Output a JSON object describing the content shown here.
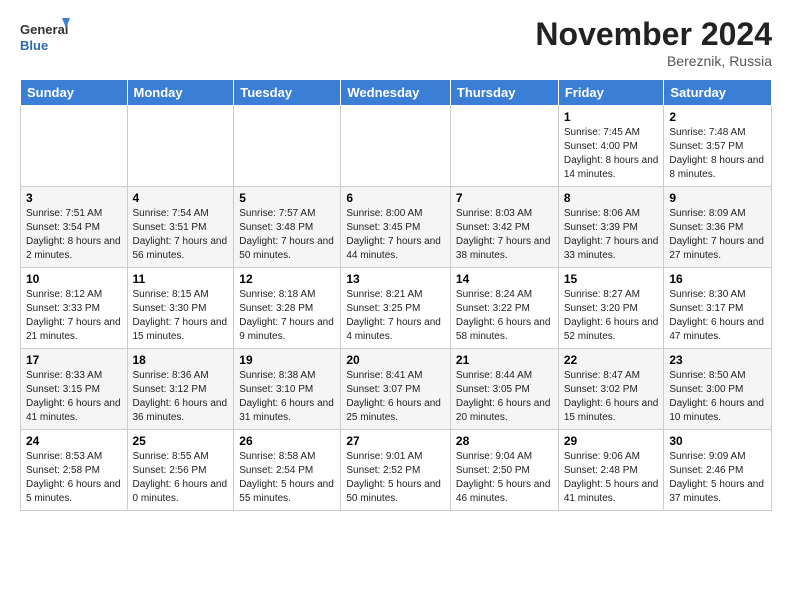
{
  "header": {
    "logo_general": "General",
    "logo_blue": "Blue",
    "month_title": "November 2024",
    "location": "Bereznik, Russia"
  },
  "weekdays": [
    "Sunday",
    "Monday",
    "Tuesday",
    "Wednesday",
    "Thursday",
    "Friday",
    "Saturday"
  ],
  "weeks": [
    [
      {
        "day": "",
        "info": ""
      },
      {
        "day": "",
        "info": ""
      },
      {
        "day": "",
        "info": ""
      },
      {
        "day": "",
        "info": ""
      },
      {
        "day": "",
        "info": ""
      },
      {
        "day": "1",
        "info": "Sunrise: 7:45 AM\nSunset: 4:00 PM\nDaylight: 8 hours and 14 minutes."
      },
      {
        "day": "2",
        "info": "Sunrise: 7:48 AM\nSunset: 3:57 PM\nDaylight: 8 hours and 8 minutes."
      }
    ],
    [
      {
        "day": "3",
        "info": "Sunrise: 7:51 AM\nSunset: 3:54 PM\nDaylight: 8 hours and 2 minutes."
      },
      {
        "day": "4",
        "info": "Sunrise: 7:54 AM\nSunset: 3:51 PM\nDaylight: 7 hours and 56 minutes."
      },
      {
        "day": "5",
        "info": "Sunrise: 7:57 AM\nSunset: 3:48 PM\nDaylight: 7 hours and 50 minutes."
      },
      {
        "day": "6",
        "info": "Sunrise: 8:00 AM\nSunset: 3:45 PM\nDaylight: 7 hours and 44 minutes."
      },
      {
        "day": "7",
        "info": "Sunrise: 8:03 AM\nSunset: 3:42 PM\nDaylight: 7 hours and 38 minutes."
      },
      {
        "day": "8",
        "info": "Sunrise: 8:06 AM\nSunset: 3:39 PM\nDaylight: 7 hours and 33 minutes."
      },
      {
        "day": "9",
        "info": "Sunrise: 8:09 AM\nSunset: 3:36 PM\nDaylight: 7 hours and 27 minutes."
      }
    ],
    [
      {
        "day": "10",
        "info": "Sunrise: 8:12 AM\nSunset: 3:33 PM\nDaylight: 7 hours and 21 minutes."
      },
      {
        "day": "11",
        "info": "Sunrise: 8:15 AM\nSunset: 3:30 PM\nDaylight: 7 hours and 15 minutes."
      },
      {
        "day": "12",
        "info": "Sunrise: 8:18 AM\nSunset: 3:28 PM\nDaylight: 7 hours and 9 minutes."
      },
      {
        "day": "13",
        "info": "Sunrise: 8:21 AM\nSunset: 3:25 PM\nDaylight: 7 hours and 4 minutes."
      },
      {
        "day": "14",
        "info": "Sunrise: 8:24 AM\nSunset: 3:22 PM\nDaylight: 6 hours and 58 minutes."
      },
      {
        "day": "15",
        "info": "Sunrise: 8:27 AM\nSunset: 3:20 PM\nDaylight: 6 hours and 52 minutes."
      },
      {
        "day": "16",
        "info": "Sunrise: 8:30 AM\nSunset: 3:17 PM\nDaylight: 6 hours and 47 minutes."
      }
    ],
    [
      {
        "day": "17",
        "info": "Sunrise: 8:33 AM\nSunset: 3:15 PM\nDaylight: 6 hours and 41 minutes."
      },
      {
        "day": "18",
        "info": "Sunrise: 8:36 AM\nSunset: 3:12 PM\nDaylight: 6 hours and 36 minutes."
      },
      {
        "day": "19",
        "info": "Sunrise: 8:38 AM\nSunset: 3:10 PM\nDaylight: 6 hours and 31 minutes."
      },
      {
        "day": "20",
        "info": "Sunrise: 8:41 AM\nSunset: 3:07 PM\nDaylight: 6 hours and 25 minutes."
      },
      {
        "day": "21",
        "info": "Sunrise: 8:44 AM\nSunset: 3:05 PM\nDaylight: 6 hours and 20 minutes."
      },
      {
        "day": "22",
        "info": "Sunrise: 8:47 AM\nSunset: 3:02 PM\nDaylight: 6 hours and 15 minutes."
      },
      {
        "day": "23",
        "info": "Sunrise: 8:50 AM\nSunset: 3:00 PM\nDaylight: 6 hours and 10 minutes."
      }
    ],
    [
      {
        "day": "24",
        "info": "Sunrise: 8:53 AM\nSunset: 2:58 PM\nDaylight: 6 hours and 5 minutes."
      },
      {
        "day": "25",
        "info": "Sunrise: 8:55 AM\nSunset: 2:56 PM\nDaylight: 6 hours and 0 minutes."
      },
      {
        "day": "26",
        "info": "Sunrise: 8:58 AM\nSunset: 2:54 PM\nDaylight: 5 hours and 55 minutes."
      },
      {
        "day": "27",
        "info": "Sunrise: 9:01 AM\nSunset: 2:52 PM\nDaylight: 5 hours and 50 minutes."
      },
      {
        "day": "28",
        "info": "Sunrise: 9:04 AM\nSunset: 2:50 PM\nDaylight: 5 hours and 46 minutes."
      },
      {
        "day": "29",
        "info": "Sunrise: 9:06 AM\nSunset: 2:48 PM\nDaylight: 5 hours and 41 minutes."
      },
      {
        "day": "30",
        "info": "Sunrise: 9:09 AM\nSunset: 2:46 PM\nDaylight: 5 hours and 37 minutes."
      }
    ]
  ]
}
